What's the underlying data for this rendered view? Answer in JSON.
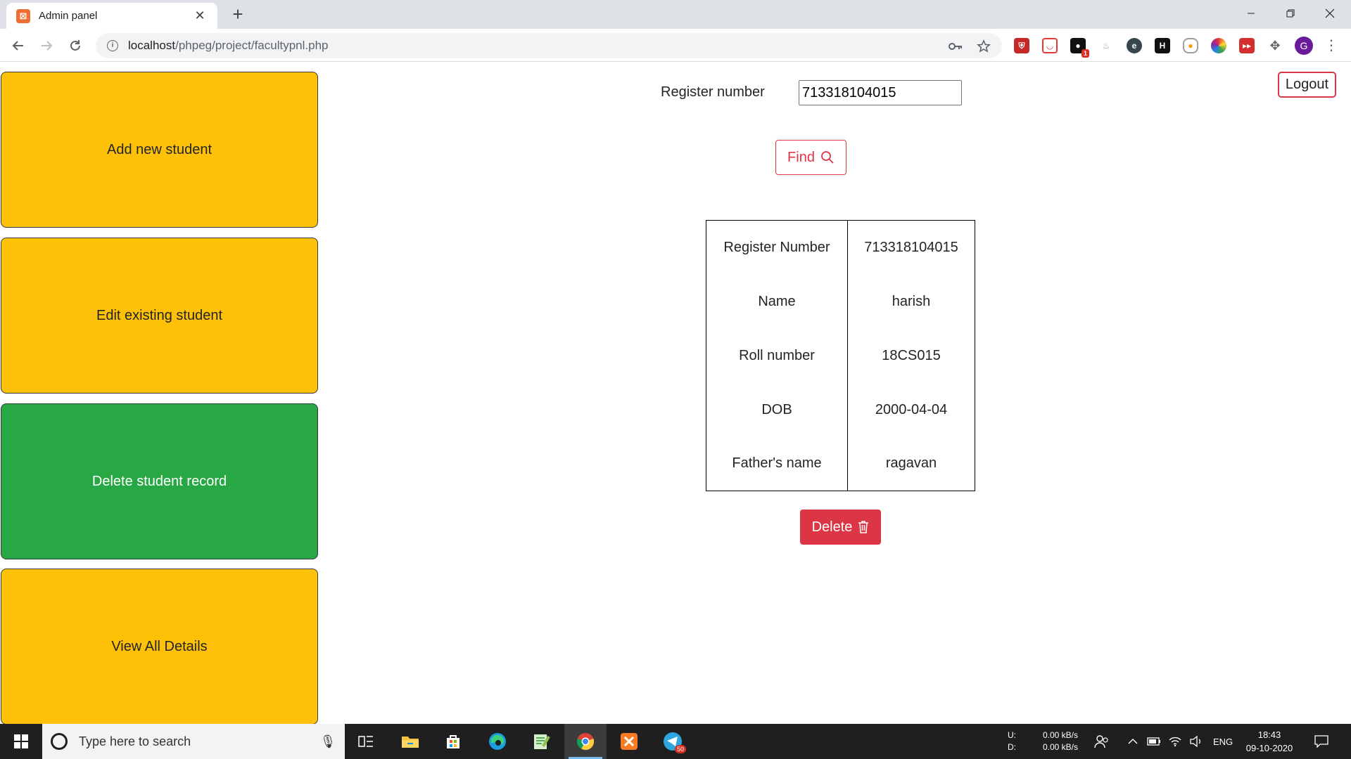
{
  "browser": {
    "tab_title": "Admin panel",
    "tab_close": "✕",
    "new_tab": "+",
    "url_host": "localhost",
    "url_path": "/phpeg/project/facultypnl.php",
    "profile_initial": "G",
    "ext_badge": "1"
  },
  "sidebar": {
    "items": [
      {
        "label": "Add new student",
        "color": "#ffc107"
      },
      {
        "label": "Edit existing student",
        "color": "#ffc107"
      },
      {
        "label": "Delete student record",
        "color": "#28a745"
      },
      {
        "label": "View All Details",
        "color": "#ffc107"
      }
    ]
  },
  "search": {
    "label": "Register number",
    "value": "713318104015",
    "find_label": "Find"
  },
  "logout_label": "Logout",
  "record": {
    "rows": [
      {
        "key": "Register Number",
        "value": "713318104015"
      },
      {
        "key": "Name",
        "value": "harish"
      },
      {
        "key": "Roll number",
        "value": "18CS015"
      },
      {
        "key": "DOB",
        "value": "2000-04-04"
      },
      {
        "key": "Father's name",
        "value": "ragavan"
      }
    ]
  },
  "delete_label": "Delete",
  "taskbar": {
    "search_placeholder": "Type here to search",
    "telegram_badge": "50",
    "net_up_label": "U:",
    "net_down_label": "D:",
    "net_up": "0.00 kB/s",
    "net_down": "0.00 kB/s",
    "lang": "ENG",
    "time": "18:43",
    "date": "09-10-2020"
  },
  "colors": {
    "danger": "#dc3545",
    "warning": "#ffc107",
    "success": "#28a745"
  }
}
